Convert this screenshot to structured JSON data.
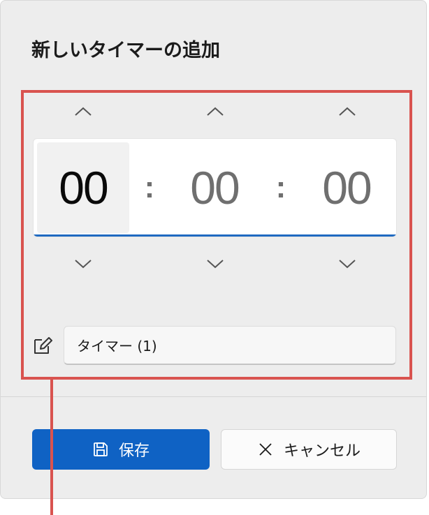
{
  "dialog": {
    "title": "新しいタイマーの追加",
    "time": {
      "hours": "00",
      "minutes": "00",
      "seconds": "00",
      "separator": ":"
    },
    "name_field": {
      "value": "タイマー (1)"
    },
    "buttons": {
      "save_label": "保存",
      "cancel_label": "キャンセル"
    }
  },
  "colors": {
    "accent": "#0f62c4",
    "highlight": "#d9534f",
    "background": "#ededed"
  },
  "icons": [
    "chevron-up-icon",
    "chevron-down-icon",
    "edit-icon",
    "save-icon",
    "close-icon"
  ]
}
